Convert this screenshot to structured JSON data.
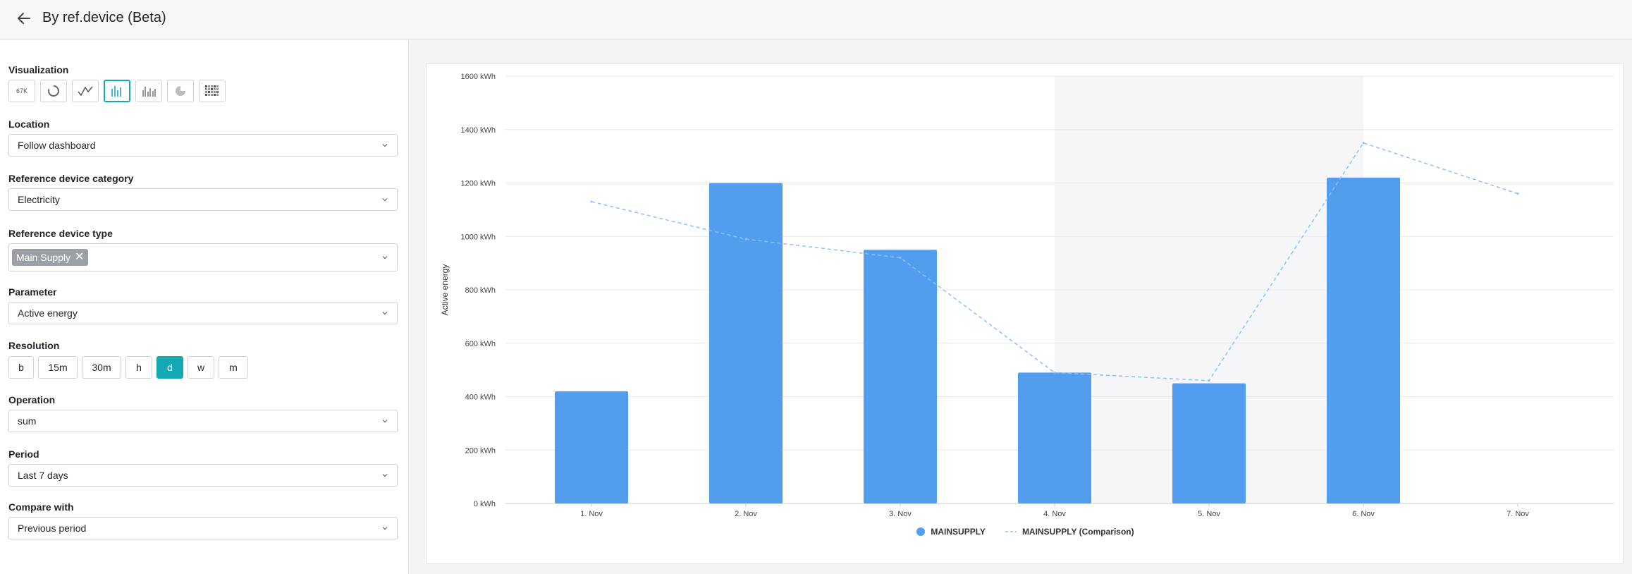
{
  "header": {
    "title": "By ref.device (Beta)"
  },
  "sidebar": {
    "visualization": {
      "label": "Visualization",
      "kpi_text": "67K",
      "active_index": 3,
      "buttons": [
        "kpi",
        "gauge",
        "line",
        "bar",
        "stacked-bar",
        "pie",
        "heatmap"
      ]
    },
    "location": {
      "label": "Location",
      "value": "Follow dashboard"
    },
    "ref_category": {
      "label": "Reference device category",
      "value": "Electricity"
    },
    "ref_type": {
      "label": "Reference device type",
      "chip": "Main Supply"
    },
    "parameter": {
      "label": "Parameter",
      "value": "Active energy"
    },
    "resolution": {
      "label": "Resolution",
      "options": [
        "b",
        "15m",
        "30m",
        "h",
        "d",
        "w",
        "m"
      ],
      "active": "d"
    },
    "operation": {
      "label": "Operation",
      "value": "sum"
    },
    "period": {
      "label": "Period",
      "value": "Last 7 days"
    },
    "compare": {
      "label": "Compare with",
      "value": "Previous period"
    }
  },
  "chart_data": {
    "type": "bar",
    "ylabel": "Active energy",
    "xlabel": "",
    "title": "",
    "unit": "kWh",
    "ylim": [
      0,
      1600
    ],
    "yticks": [
      0,
      200,
      400,
      600,
      800,
      1000,
      1200,
      1400,
      1600
    ],
    "ytick_labels": [
      "0 kWh",
      "200 kWh",
      "400 kWh",
      "600 kWh",
      "800 kWh",
      "1000 kWh",
      "1200 kWh",
      "1400 kWh",
      "1600 kWh"
    ],
    "categories": [
      "1. Nov",
      "2. Nov",
      "3. Nov",
      "4. Nov",
      "5. Nov",
      "6. Nov",
      "7. Nov"
    ],
    "highlight_range": [
      "4. Nov",
      "5. Nov"
    ],
    "grid": true,
    "legend_position": "bottom-center",
    "series": [
      {
        "name": "MAINSUPPLY",
        "kind": "bar",
        "color": "#539def",
        "values": [
          420,
          1200,
          950,
          490,
          450,
          1220,
          null
        ]
      },
      {
        "name": "MAINSUPPLY (Comparison)",
        "kind": "dashed-line",
        "color": "#8cc0f5",
        "values": [
          1130,
          990,
          920,
          490,
          460,
          1350,
          1160
        ]
      }
    ]
  }
}
